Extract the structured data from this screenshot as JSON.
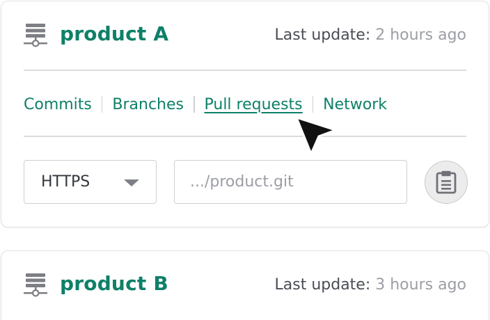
{
  "repos": [
    {
      "name": "product A",
      "update_label": "Last update:",
      "update_value": "2 hours ago",
      "nav": [
        "Commits",
        "Branches",
        "Pull requests",
        "Network"
      ],
      "active_nav": "Pull requests",
      "protocol": "HTTPS",
      "clone_placeholder": ".../product.git"
    },
    {
      "name": "product B",
      "update_label": "Last update:",
      "update_value": "3 hours ago"
    }
  ],
  "colors": {
    "accent": "#0f8068",
    "muted": "#9c9ea5",
    "border": "#dcdcdc"
  },
  "icons": {
    "repo": "server-repo-icon",
    "dropdown": "caret-down-icon",
    "copy": "clipboard-icon",
    "cursor": "mouse-pointer-icon"
  }
}
